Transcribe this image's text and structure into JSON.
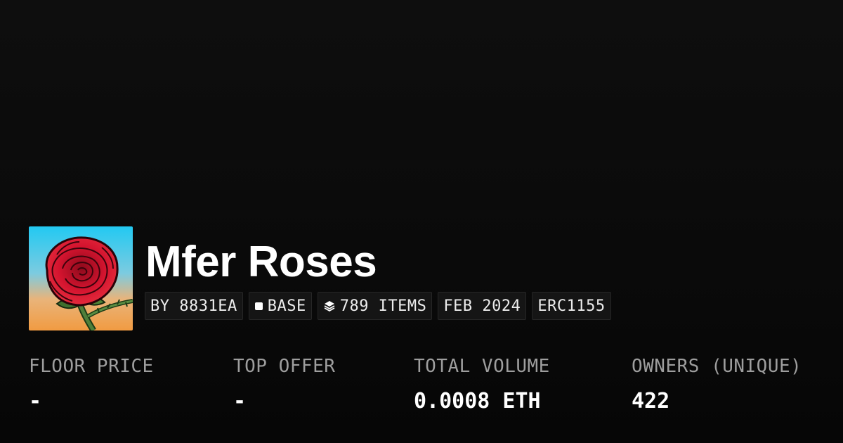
{
  "collection": {
    "name": "Mfer Roses"
  },
  "tags": [
    {
      "label": "BY 8831EA",
      "icon": ""
    },
    {
      "label": "BASE",
      "icon": "square-icon"
    },
    {
      "label": "789 ITEMS",
      "icon": "layers-icon"
    },
    {
      "label": "FEB 2024",
      "icon": ""
    },
    {
      "label": "ERC1155",
      "icon": ""
    }
  ],
  "stats": [
    {
      "label": "FLOOR PRICE",
      "value": "-"
    },
    {
      "label": "TOP OFFER",
      "value": "-"
    },
    {
      "label": "TOTAL VOLUME",
      "value": "0.0008 ETH"
    },
    {
      "label": "OWNERS (UNIQUE)",
      "value": "422"
    }
  ],
  "colors": {
    "background": "#0b0b0b",
    "tag_background": "#151515",
    "label_gray": "#9e9e9e",
    "rose_red": "#c8102e",
    "sky_blue": "#2bc7ef",
    "sky_orange": "#f0a44a"
  }
}
